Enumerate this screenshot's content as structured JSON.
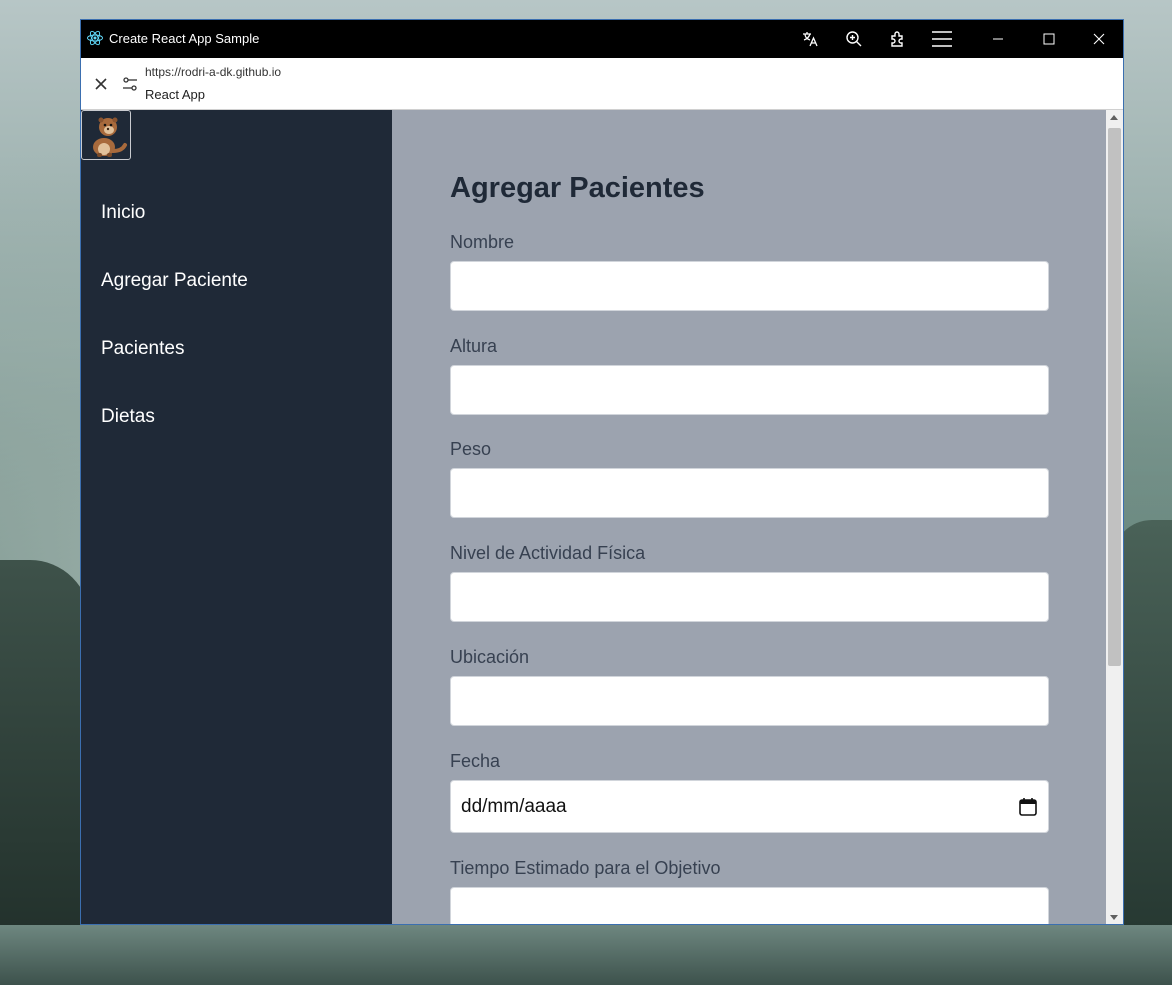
{
  "window": {
    "title": "Create React App Sample",
    "controls": [
      "translate-icon",
      "zoom-icon",
      "extensions-icon",
      "menu-icon",
      "minimize-icon",
      "maximize-icon",
      "close-icon"
    ]
  },
  "address_bar": {
    "url": "https://rodri-a-dk.github.io",
    "page_title": "React App"
  },
  "sidebar": {
    "logo": "otter-logo",
    "items": [
      {
        "label": "Inicio"
      },
      {
        "label": "Agregar Paciente"
      },
      {
        "label": "Pacientes"
      },
      {
        "label": "Dietas"
      }
    ]
  },
  "form": {
    "title": "Agregar Pacientes",
    "fields": [
      {
        "label": "Nombre",
        "value": ""
      },
      {
        "label": "Altura",
        "value": ""
      },
      {
        "label": "Peso",
        "value": ""
      },
      {
        "label": "Nivel de Actividad Física",
        "value": ""
      },
      {
        "label": "Ubicación",
        "value": ""
      },
      {
        "label": "Fecha",
        "value": "dd/mm/aaaa"
      },
      {
        "label": "Tiempo Estimado para el Objetivo",
        "value": ""
      }
    ]
  },
  "colors": {
    "sidebar_bg": "#1f2937",
    "main_bg": "#9ca3af",
    "title_color": "#1f2937",
    "label_color": "#374151",
    "react_logo": "#61dafb"
  }
}
